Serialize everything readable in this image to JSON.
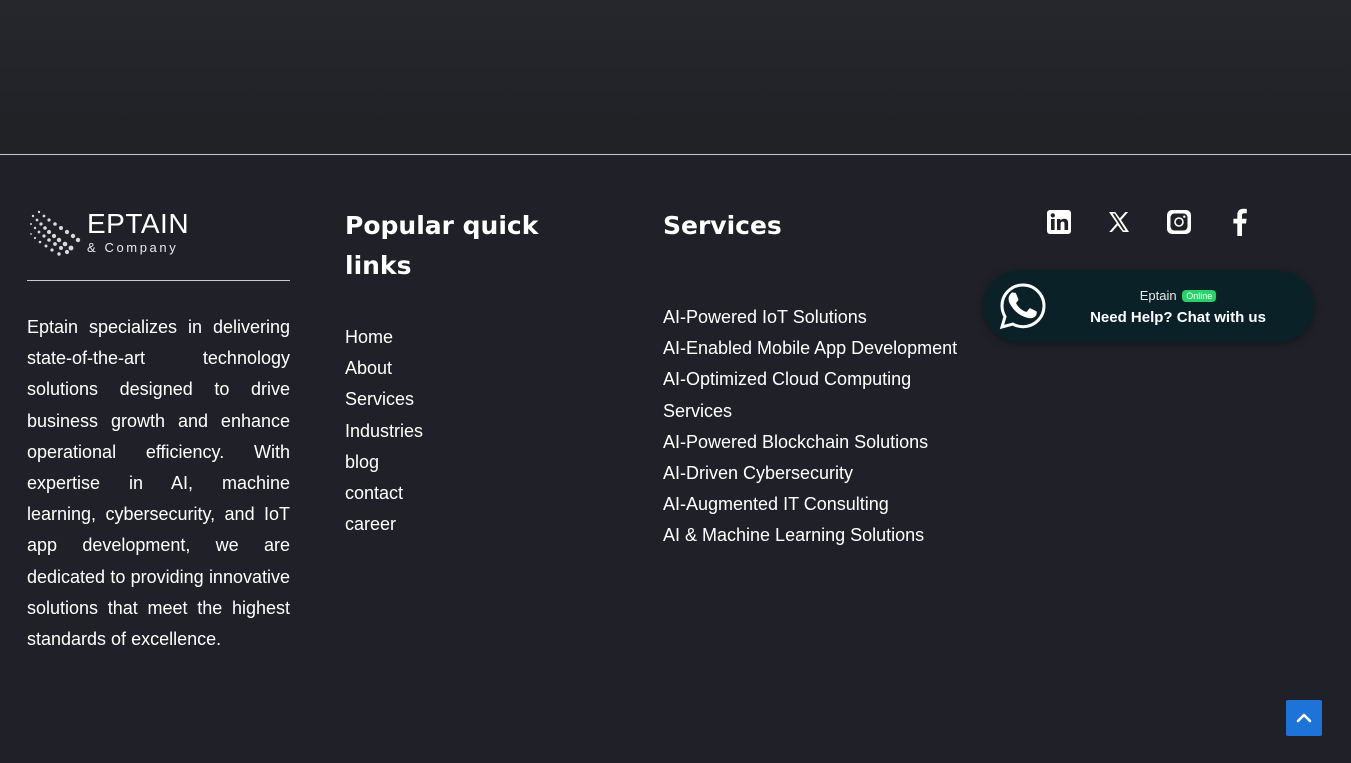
{
  "brand": {
    "logo_name": "EPTAIN",
    "logo_sub": "& Company",
    "description": "Eptain specializes in delivering state-of-the-art technology solutions designed to drive business growth and enhance operational efficiency. With expertise in AI, machine learning, cybersecurity, and IoT app development, we are dedicated to providing innovative solutions that meet the highest standards of excellence."
  },
  "quick_links": {
    "heading": "Popular quick links",
    "items": [
      "Home",
      "About",
      "Services",
      "Industries",
      "blog",
      "contact",
      "career"
    ]
  },
  "services": {
    "heading": "Services",
    "items": [
      "AI-Powered IoT Solutions",
      "AI-Enabled Mobile App Development",
      "AI-Optimized Cloud Computing Services",
      "AI-Powered Blockchain Solutions",
      "AI-Driven Cybersecurity",
      "AI-Augmented IT Consulting",
      "AI & Machine Learning Solutions"
    ]
  },
  "social": {
    "icons": [
      "linkedin-icon",
      "x-twitter-icon",
      "instagram-icon",
      "facebook-icon"
    ]
  },
  "chat_widget": {
    "name": "Eptain",
    "status": "Online",
    "cta": "Need Help? Chat with us",
    "icon": "whatsapp-icon"
  },
  "scroll_top": {
    "icon": "chevron-up-icon"
  },
  "colors": {
    "background": "#202128",
    "chat_bg": "#0a2227",
    "status_green": "#25d366",
    "scroll_button": "#1e73d9"
  }
}
